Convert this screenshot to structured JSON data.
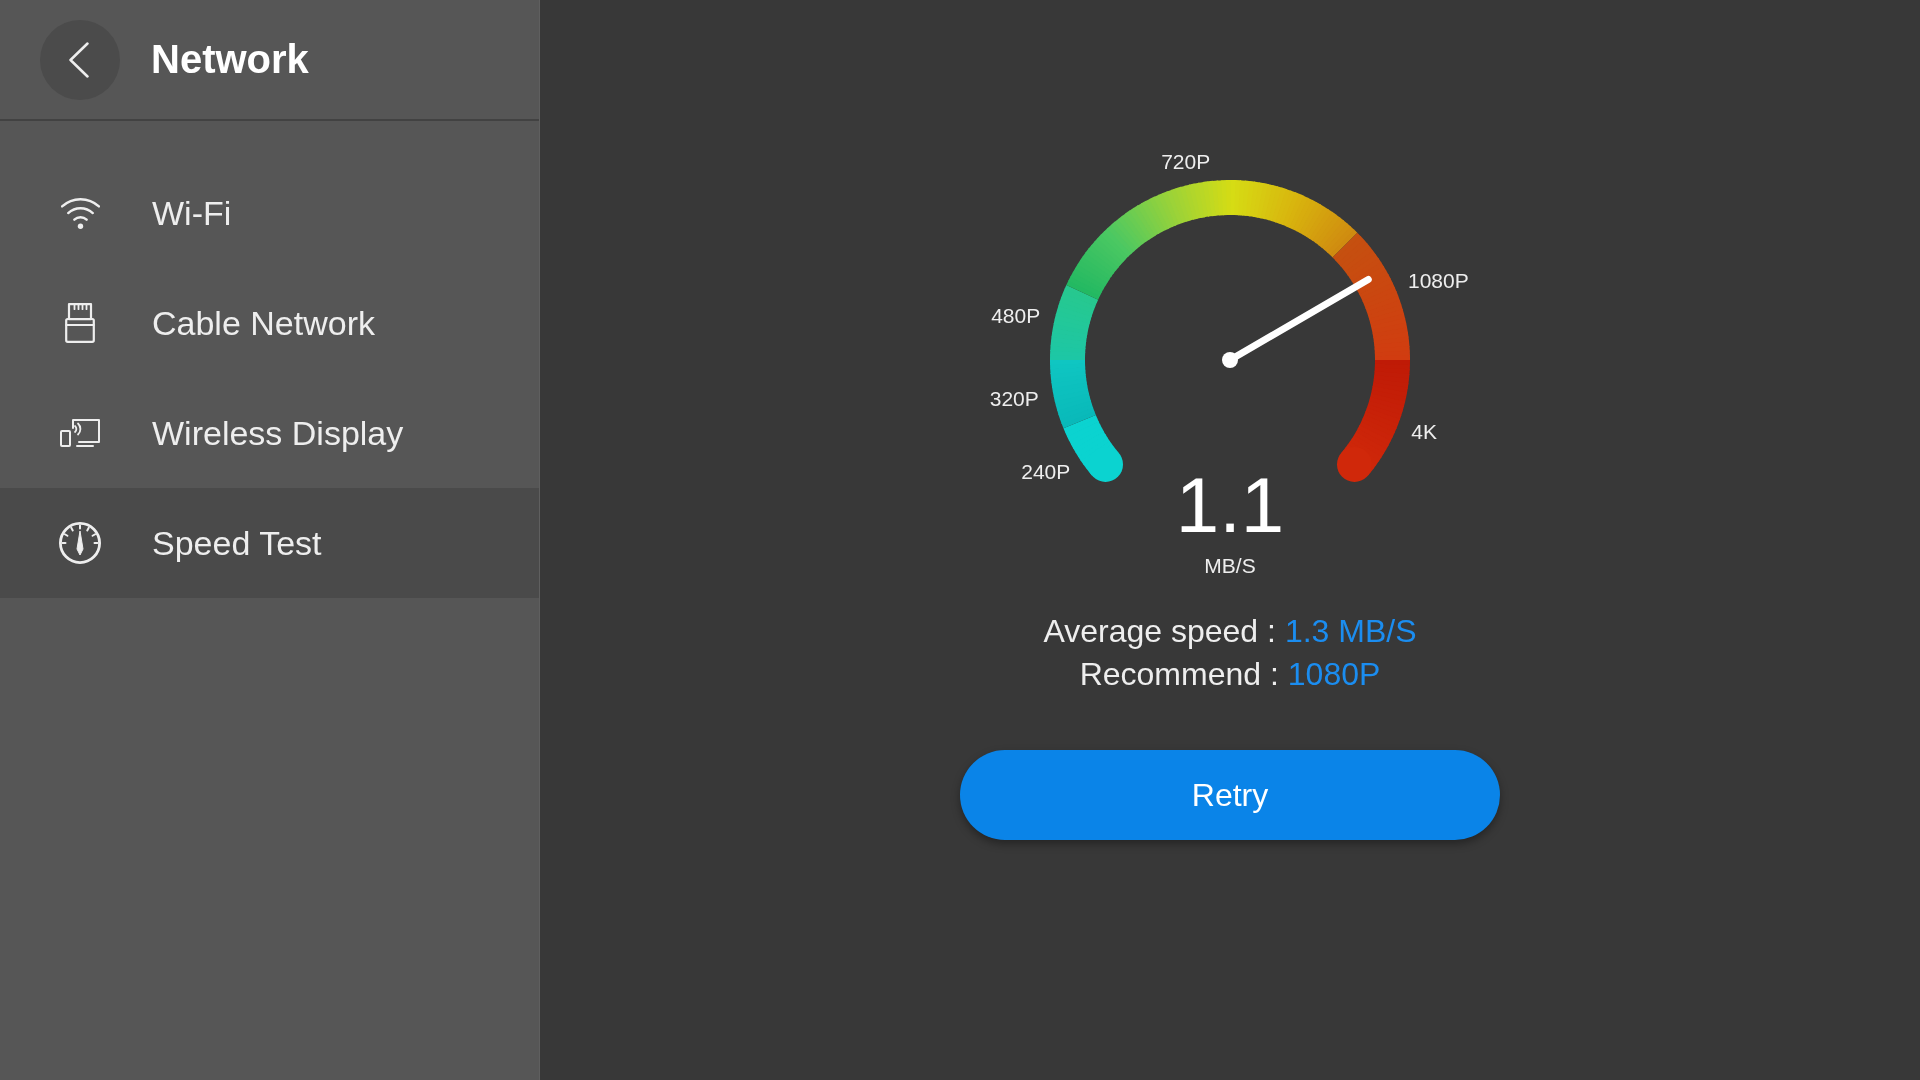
{
  "header": {
    "title": "Network"
  },
  "sidebar": {
    "items": [
      {
        "label": "Wi-Fi",
        "selected": false
      },
      {
        "label": "Cable Network",
        "selected": false
      },
      {
        "label": "Wireless Display",
        "selected": false
      },
      {
        "label": "Speed Test",
        "selected": true
      }
    ]
  },
  "gauge": {
    "scale": [
      "240P",
      "320P",
      "480P",
      "720P",
      "1080P",
      "4K"
    ],
    "level": 0.73,
    "value": "1.1",
    "unit": "MB/S"
  },
  "results": [
    {
      "label": "Average speed :",
      "value": "1.3 MB/S"
    },
    {
      "label": "Recommend :",
      "value": "1080P"
    }
  ],
  "buttons": [
    "Retry"
  ]
}
